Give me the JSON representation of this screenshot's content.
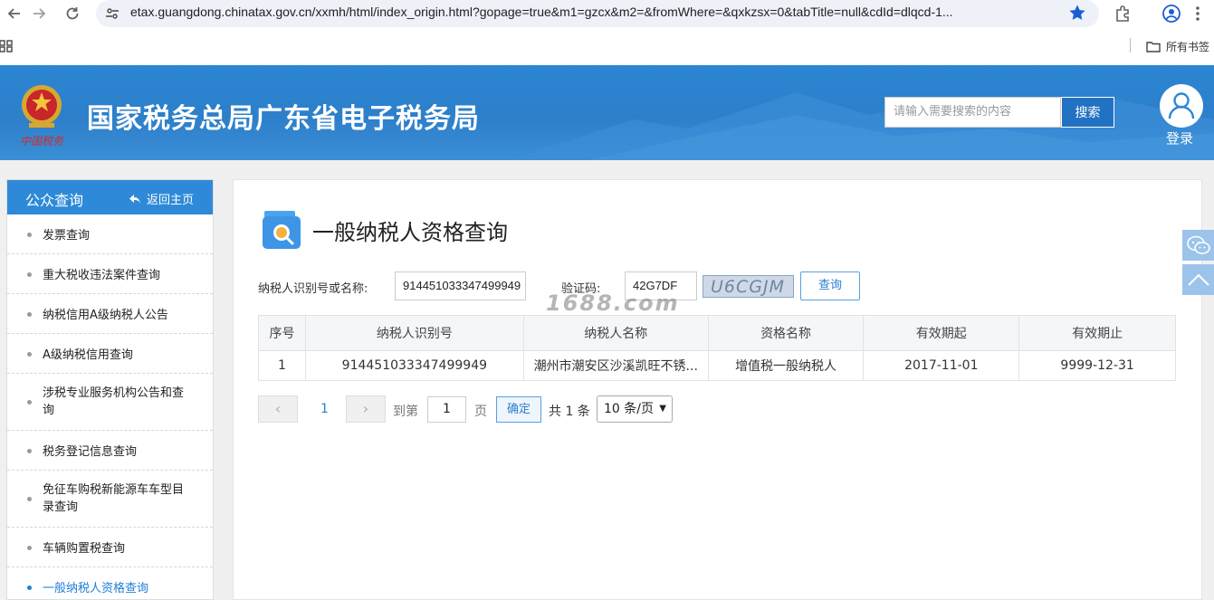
{
  "browser": {
    "url": "etax.guangdong.chinatax.gov.cn/xxmh/html/index_origin.html?gopage=true&m1=gzcx&m2=&fromWhere=&qxkzsx=0&tabTitle=null&cdId=dlqcd-1...",
    "bookmarks_folder": "所有书签"
  },
  "header": {
    "title": "国家税务总局广东省电子税务局",
    "emblem_text": "中国税务",
    "search_placeholder": "请输入需要搜索的内容",
    "search_label": "搜索",
    "login_label": "登录"
  },
  "sidebar": {
    "title": "公众查询",
    "back_label": "返回主页",
    "items": [
      {
        "label": "发票查询"
      },
      {
        "label": "重大税收违法案件查询"
      },
      {
        "label": "纳税信用A级纳税人公告"
      },
      {
        "label": "A级纳税信用查询"
      },
      {
        "label": "涉税专业服务机构公告和查询"
      },
      {
        "label": "税务登记信息查询"
      },
      {
        "label": "免征车购税新能源车车型目录查询"
      },
      {
        "label": "车辆购置税查询"
      },
      {
        "label": "一般纳税人资格查询"
      }
    ]
  },
  "main": {
    "page_title": "一般纳税人资格查询",
    "form": {
      "taxpayer_label": "纳税人识别号或名称:",
      "taxpayer_value": "914451033347499949",
      "captcha_label": "验证码:",
      "captcha_value": "42G7DF",
      "captcha_image_text": "U6CGJM",
      "query_label": "查询"
    },
    "watermark": "1688.com",
    "table": {
      "headers": [
        "序号",
        "纳税人识别号",
        "纳税人名称",
        "资格名称",
        "有效期起",
        "有效期止"
      ],
      "rows": [
        [
          "1",
          "914451033347499949",
          "潮州市潮安区沙溪凯旺不锈...",
          "增值税一般纳税人",
          "2017-11-01",
          "9999-12-31"
        ]
      ]
    },
    "pagination": {
      "prev": "‹",
      "next": "›",
      "current_page": "1",
      "goto_label": "到第",
      "goto_value": "1",
      "page_unit": "页",
      "confirm_label": "确定",
      "total_label": "共 1 条",
      "page_size": "10 条/页"
    }
  },
  "colors": {
    "header_blue": "#2d7fc9",
    "sidebar_head": "#2e8ad8",
    "accent": "#2b7fd3"
  }
}
